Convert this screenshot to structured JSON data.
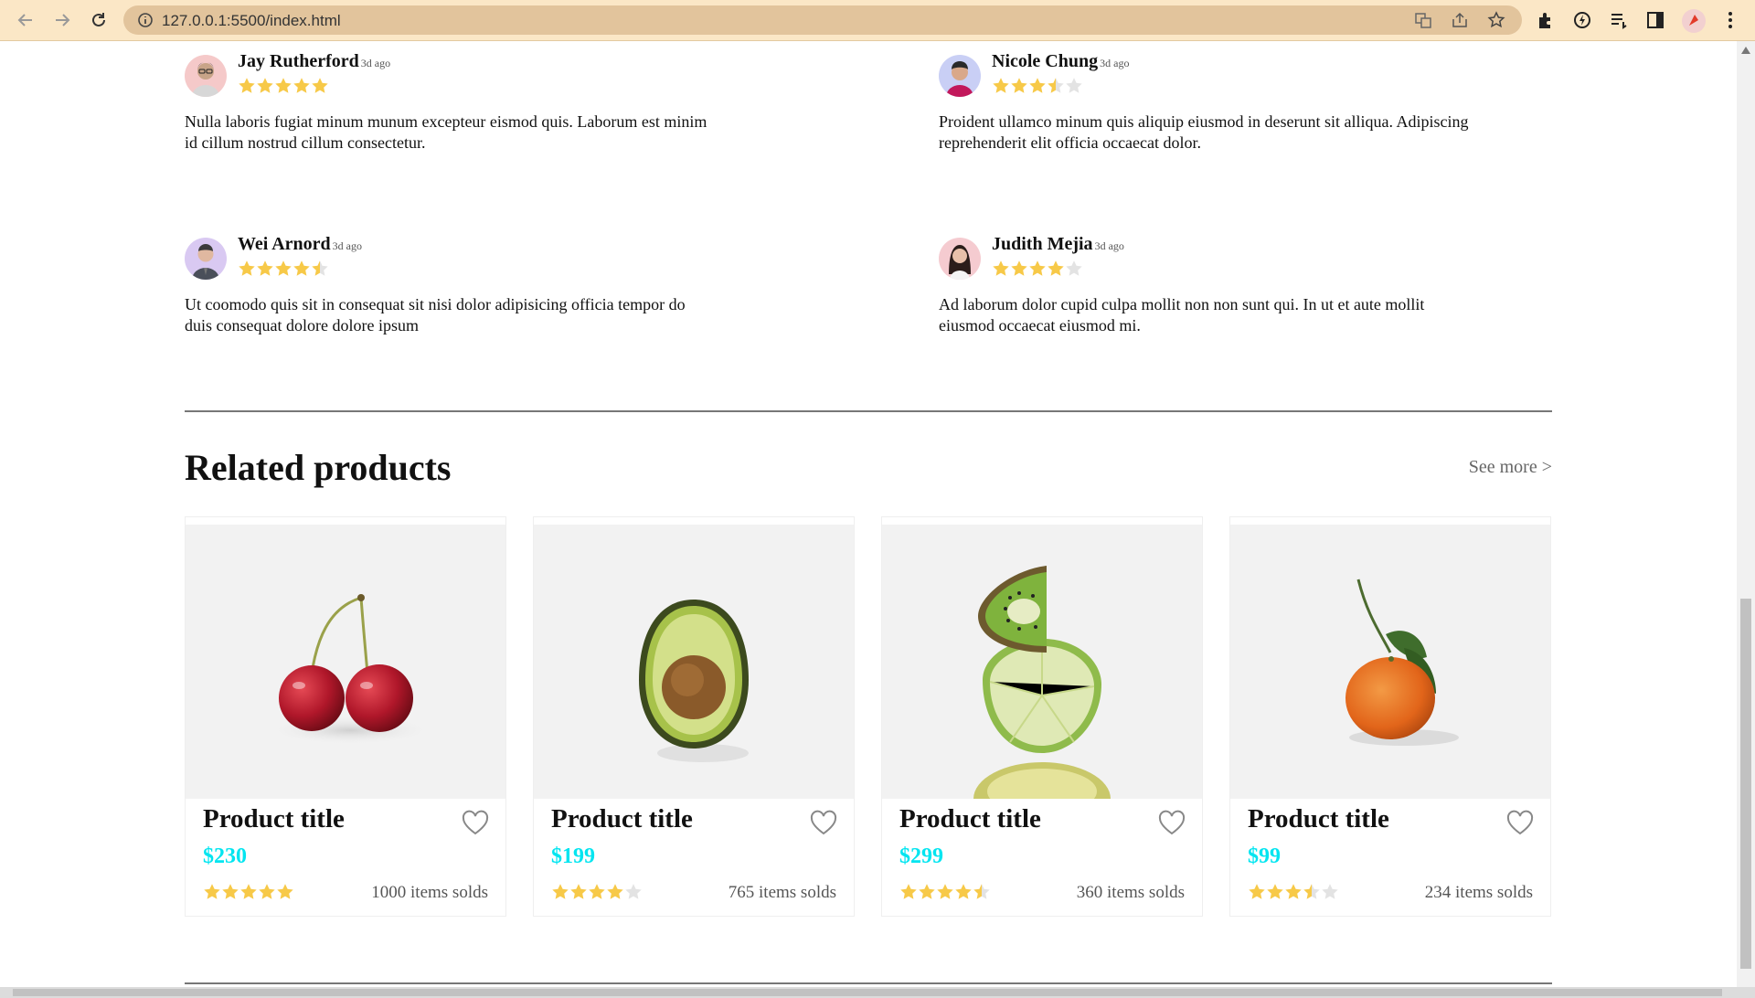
{
  "browser": {
    "url": "127.0.0.1:5500/index.html"
  },
  "colors": {
    "star": "#f7c948",
    "star_empty": "#e3e3e3",
    "price": "#00e5f0",
    "browser_bar": "#fbe7c6"
  },
  "reviews": [
    {
      "name": "Jay Rutherford",
      "time": "3d ago",
      "rating": 5,
      "text": "Nulla laboris fugiat minum munum excepteur eismod quis. Laborum est minim id cillum nostrud cillum consectetur."
    },
    {
      "name": "Nicole Chung",
      "time": "3d ago",
      "rating": 3.5,
      "text": "Proident ullamco minum quis aliquip eiusmod in deserunt sit alliqua. Adipiscing reprehenderit elit officia occaecat dolor."
    },
    {
      "name": "Wei Arnord",
      "time": "3d ago",
      "rating": 4.5,
      "text": "Ut coomodo quis sit in consequat sit nisi dolor adipisicing officia tempor do duis consequat dolore dolore ipsum"
    },
    {
      "name": "Judith Mejia",
      "time": "3d ago",
      "rating": 4,
      "text": "Ad laborum dolor cupid culpa mollit non non sunt qui. In ut et aute mollit eiusmod occaecat eiusmod mi."
    }
  ],
  "related": {
    "title": "Related products",
    "see_more": "See more >",
    "products": [
      {
        "title": "Product title",
        "price": "$230",
        "rating": 5,
        "sold": "1000 items solds",
        "image": "cherries"
      },
      {
        "title": "Product title",
        "price": "$199",
        "rating": 4,
        "sold": "765 items solds",
        "image": "avocado"
      },
      {
        "title": "Product title",
        "price": "$299",
        "rating": 4.5,
        "sold": "360 items solds",
        "image": "kiwi-lime"
      },
      {
        "title": "Product title",
        "price": "$99",
        "rating": 3.5,
        "sold": "234 items solds",
        "image": "tangerine"
      }
    ]
  }
}
